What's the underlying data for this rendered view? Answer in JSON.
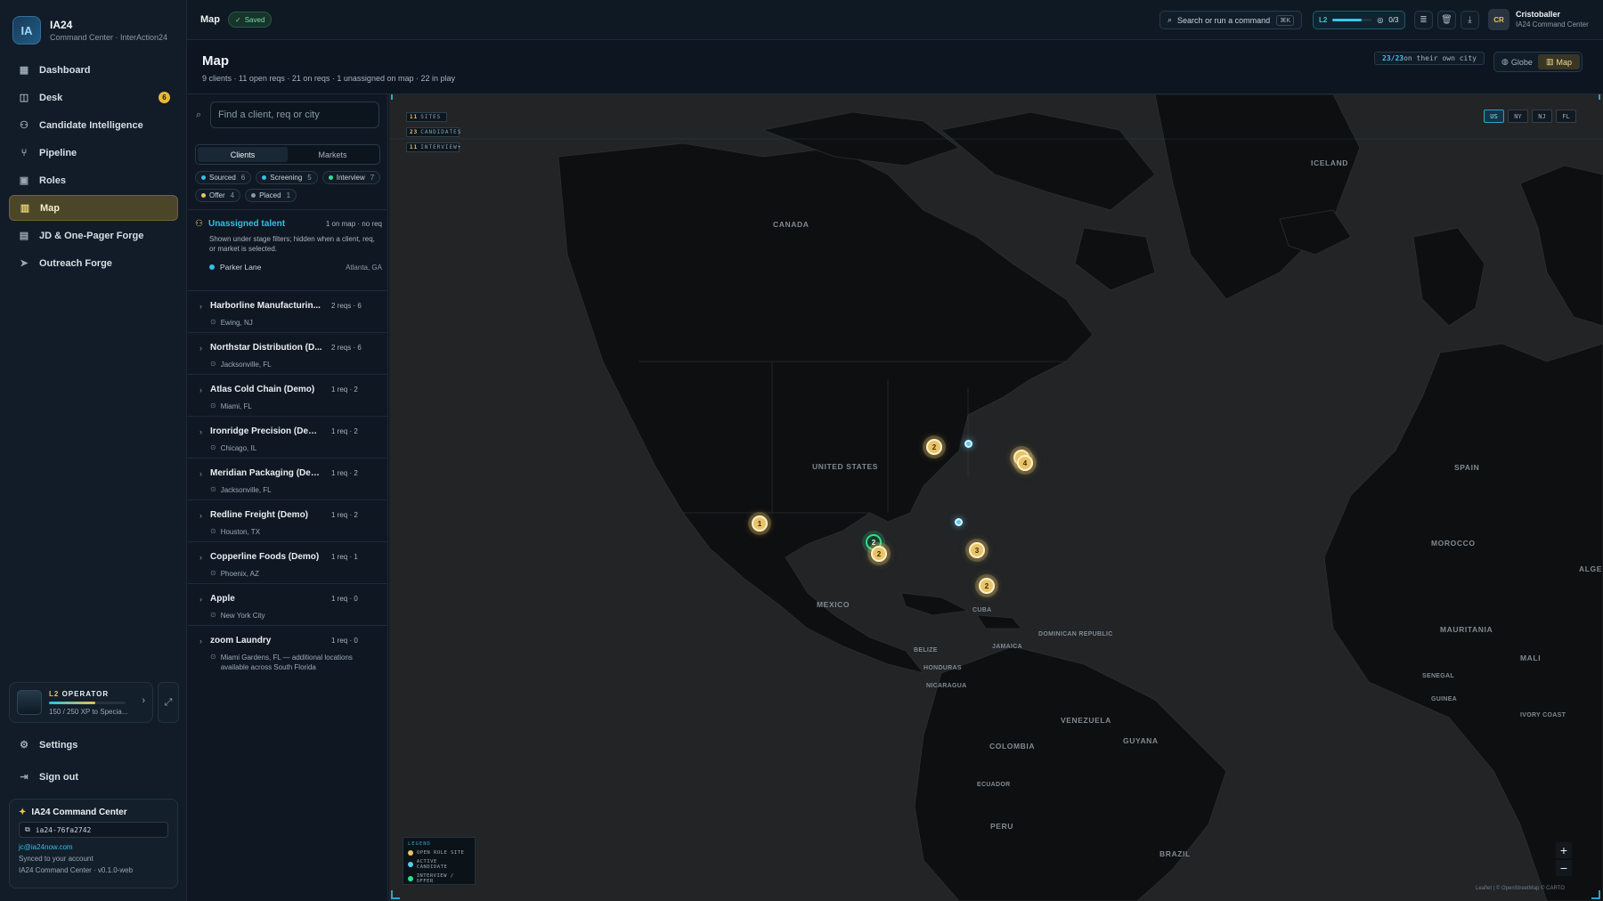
{
  "brand": {
    "title": "IA24",
    "subtitle": "Command Center · InterAction24",
    "logo_text": "IA"
  },
  "nav": [
    {
      "label": "Dashboard",
      "icon": "grid-icon"
    },
    {
      "label": "Desk",
      "icon": "panel-icon",
      "badge": "6"
    },
    {
      "label": "Candidate Intelligence",
      "icon": "users-icon"
    },
    {
      "label": "Pipeline",
      "icon": "git-branch-icon"
    },
    {
      "label": "Roles",
      "icon": "briefcase-icon"
    },
    {
      "label": "Map",
      "icon": "map-icon",
      "active": true
    },
    {
      "label": "JD & One-Pager Forge",
      "icon": "file-icon"
    },
    {
      "label": "Outreach Forge",
      "icon": "send-icon"
    }
  ],
  "operator": {
    "level": "L2",
    "title": "OPERATOR",
    "xp": "150 / 250 XP to Specia...",
    "progress": 0.6
  },
  "settings_label": "Settings",
  "signout_label": "Sign out",
  "account": {
    "title": "IA24 Command Center",
    "id": "ia24-76fa2742",
    "email": "jc@ia24now.com",
    "synced": "Synced to your account",
    "version": "IA24 Command Center · v0.1.0-web"
  },
  "topbar": {
    "crumb": "Map",
    "saved": "Saved",
    "search_label": "Search or run a command",
    "search_kbd": "⌘K",
    "level": "L2",
    "level_progress": 0.75,
    "quests": "0/3",
    "user_initials": "CR",
    "user_name": "Cristoballer",
    "user_sub": "IA24 Command Center"
  },
  "page": {
    "title": "Map",
    "subtitle": "9 clients · 11 open reqs · 21 on reqs · 1 unassigned on map · 22 in play",
    "own_city_count": "23/23",
    "own_city_text": " on their own city",
    "view_globe": "Globe",
    "view_map": "Map"
  },
  "panel": {
    "search_placeholder": "Find a client, req or city",
    "tabs": [
      "Clients",
      "Markets"
    ],
    "stages": [
      {
        "label": "Sourced",
        "count": "6",
        "color": "#34bfe6"
      },
      {
        "label": "Screening",
        "count": "5",
        "color": "#34bfe6"
      },
      {
        "label": "Interview",
        "count": "7",
        "color": "#2fe08f"
      },
      {
        "label": "Offer",
        "count": "4",
        "color": "#e9c36a"
      },
      {
        "label": "Placed",
        "count": "1",
        "color": "#8a99a8"
      }
    ],
    "unassigned": {
      "title": "Unassigned talent",
      "meta": "1 on map · no req",
      "note": "Shown under stage filters; hidden when a client, req, or market is selected.",
      "person": "Parker Lane",
      "person_city": "Atlanta, GA"
    },
    "clients": [
      {
        "name": "Harborline Manufacturin...",
        "meta": "2 reqs · 6",
        "location": "Ewing, NJ"
      },
      {
        "name": "Northstar Distribution (D...",
        "meta": "2 reqs · 6",
        "location": "Jacksonville, FL"
      },
      {
        "name": "Atlas Cold Chain (Demo)",
        "meta": "1 req · 2",
        "location": "Miami, FL"
      },
      {
        "name": "Ironridge Precision (Demo)",
        "meta": "1 req · 2",
        "location": "Chicago, IL"
      },
      {
        "name": "Meridian Packaging (Demo)",
        "meta": "1 req · 2",
        "location": "Jacksonville, FL"
      },
      {
        "name": "Redline Freight (Demo)",
        "meta": "1 req · 2",
        "location": "Houston, TX"
      },
      {
        "name": "Copperline Foods (Demo)",
        "meta": "1 req · 1",
        "location": "Phoenix, AZ"
      },
      {
        "name": "Apple",
        "meta": "1 req · 0",
        "location": "New York City"
      },
      {
        "name": "zoom Laundry",
        "meta": "1 req · 0",
        "location": "Miami Gardens, FL — additional locations available across South Florida"
      }
    ]
  },
  "map": {
    "hud": [
      {
        "value": "11",
        "label": "SITES"
      },
      {
        "value": "23",
        "label": "CANDIDATES"
      },
      {
        "value": "11",
        "label": "INTERVIEW+"
      }
    ],
    "regions": [
      "US",
      "NY",
      "NJ",
      "FL"
    ],
    "active_region": "US",
    "labels": {
      "canada": "CANADA",
      "us": "UNITED STATES",
      "mexico": "MEXICO",
      "cuba": "CUBA",
      "venezuela": "VENEZUELA",
      "colombia": "COLOMBIA",
      "guyana": "GUYANA",
      "ecuador": "ECUADOR",
      "peru": "PERU",
      "brazil": "BRAZIL",
      "iceland": "ICELAND",
      "spain": "SPAIN",
      "morocco": "MOROCCO",
      "algeria": "ALGE",
      "mauritania": "MAURITANIA",
      "mali": "MALI",
      "senegal": "SENEGAL",
      "ivory": "IVORY COAST",
      "belize": "BELIZE",
      "honduras": "HONDURAS",
      "jamaica": "JAMAICA",
      "dominican": "DOMINICAN REPUBLIC",
      "nicaragua": "NICARAGUA",
      "guinea": "GUINEA"
    },
    "clusters": [
      {
        "label": "2",
        "kind": "site"
      },
      {
        "label": "4",
        "kind": "site"
      },
      {
        "label": "1",
        "kind": "site"
      },
      {
        "label": "2",
        "kind": "interview"
      },
      {
        "label": "2",
        "kind": "site"
      },
      {
        "label": "3",
        "kind": "site"
      },
      {
        "label": "2",
        "kind": "site"
      }
    ],
    "legend": {
      "title": "LEGEND",
      "items": [
        {
          "label": "OPEN ROLE SITE",
          "color": "#e9c36a"
        },
        {
          "label": "ACTIVE CANDIDATE",
          "color": "#5cc9ef"
        },
        {
          "label": "INTERVIEW / OFFER",
          "color": "#2fe08f"
        }
      ]
    },
    "zoom_in": "+",
    "zoom_out": "−",
    "attribution": "Leaflet | © OpenStreetMap © CARTO"
  }
}
